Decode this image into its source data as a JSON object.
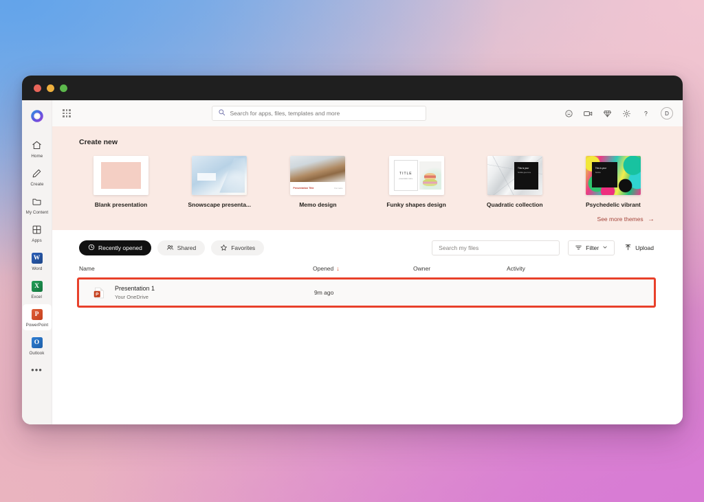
{
  "window": {
    "traffic_lights": [
      "close",
      "minimize",
      "maximize"
    ]
  },
  "rail": {
    "logo": "microsoft-365-copilot-logo",
    "items": [
      {
        "label": "Home",
        "icon": "home-icon",
        "selected": false
      },
      {
        "label": "Create",
        "icon": "pencil-icon",
        "selected": false
      },
      {
        "label": "My Content",
        "icon": "folder-icon",
        "selected": false
      },
      {
        "label": "Apps",
        "icon": "apps-grid-icon",
        "selected": false
      },
      {
        "label": "Word",
        "icon": "word-app-icon",
        "selected": false
      },
      {
        "label": "Excel",
        "icon": "excel-app-icon",
        "selected": false
      },
      {
        "label": "PowerPoint",
        "icon": "powerpoint-app-icon",
        "selected": true
      },
      {
        "label": "Outlook",
        "icon": "outlook-app-icon",
        "selected": false
      }
    ],
    "more_label": "•••"
  },
  "topbar": {
    "app_launcher": "waffle-grid-icon",
    "search": {
      "placeholder": "Search for apps, files, templates and more",
      "value": "",
      "icon": "search-icon"
    },
    "icons": [
      {
        "name": "feedback-smiley-icon"
      },
      {
        "name": "video-camera-icon"
      },
      {
        "name": "diamond-premium-icon"
      },
      {
        "name": "gear-settings-icon"
      },
      {
        "name": "help-question-icon"
      }
    ],
    "avatar_initial": "D"
  },
  "create_new": {
    "title": "Create new",
    "templates": [
      {
        "label": "Blank presentation",
        "art": "blank"
      },
      {
        "label": "Snowscape presenta...",
        "art": "snow"
      },
      {
        "label": "Memo design",
        "art": "memo"
      },
      {
        "label": "Funky shapes design",
        "art": "funky"
      },
      {
        "label": "Quadratic collection",
        "art": "quad"
      },
      {
        "label": "Psychedelic vibrant",
        "art": "psy"
      }
    ],
    "see_more": {
      "label": "See more themes",
      "arrow": "→",
      "color": "#a4443a"
    },
    "thumb_art_text": {
      "memo_title": "Presentation Title",
      "memo_sub": "Your name",
      "funky_title": "TITLE",
      "funky_sub": "presentation name",
      "quad_line1": "This is your",
      "quad_line2": "Subtitle goes here",
      "psy_line1": "This is your",
      "psy_line2": "Subtitle"
    }
  },
  "files": {
    "tabs": [
      {
        "label": "Recently opened",
        "icon": "clock-icon",
        "active": true
      },
      {
        "label": "Shared",
        "icon": "people-icon",
        "active": false
      },
      {
        "label": "Favorites",
        "icon": "star-icon",
        "active": false
      }
    ],
    "search": {
      "placeholder": "Search my files",
      "value": ""
    },
    "filter": {
      "label": "Filter",
      "icon": "filter-icon",
      "chevron": "⌄"
    },
    "upload": {
      "label": "Upload",
      "icon": "upload-arrow-icon"
    },
    "columns": [
      {
        "key": "name",
        "label": "Name"
      },
      {
        "key": "opened",
        "label": "Opened",
        "sorted": true,
        "sort_arrow": "↓",
        "sort_color": "#d9512c"
      },
      {
        "key": "owner",
        "label": "Owner"
      },
      {
        "key": "activity",
        "label": "Activity"
      }
    ],
    "rows": [
      {
        "icon": "powerpoint-file-icon",
        "name": "Presentation 1",
        "location": "Your OneDrive",
        "opened": "9m ago",
        "owner": "",
        "activity": "",
        "highlighted": true,
        "highlight_color": "#e8402a"
      }
    ]
  }
}
